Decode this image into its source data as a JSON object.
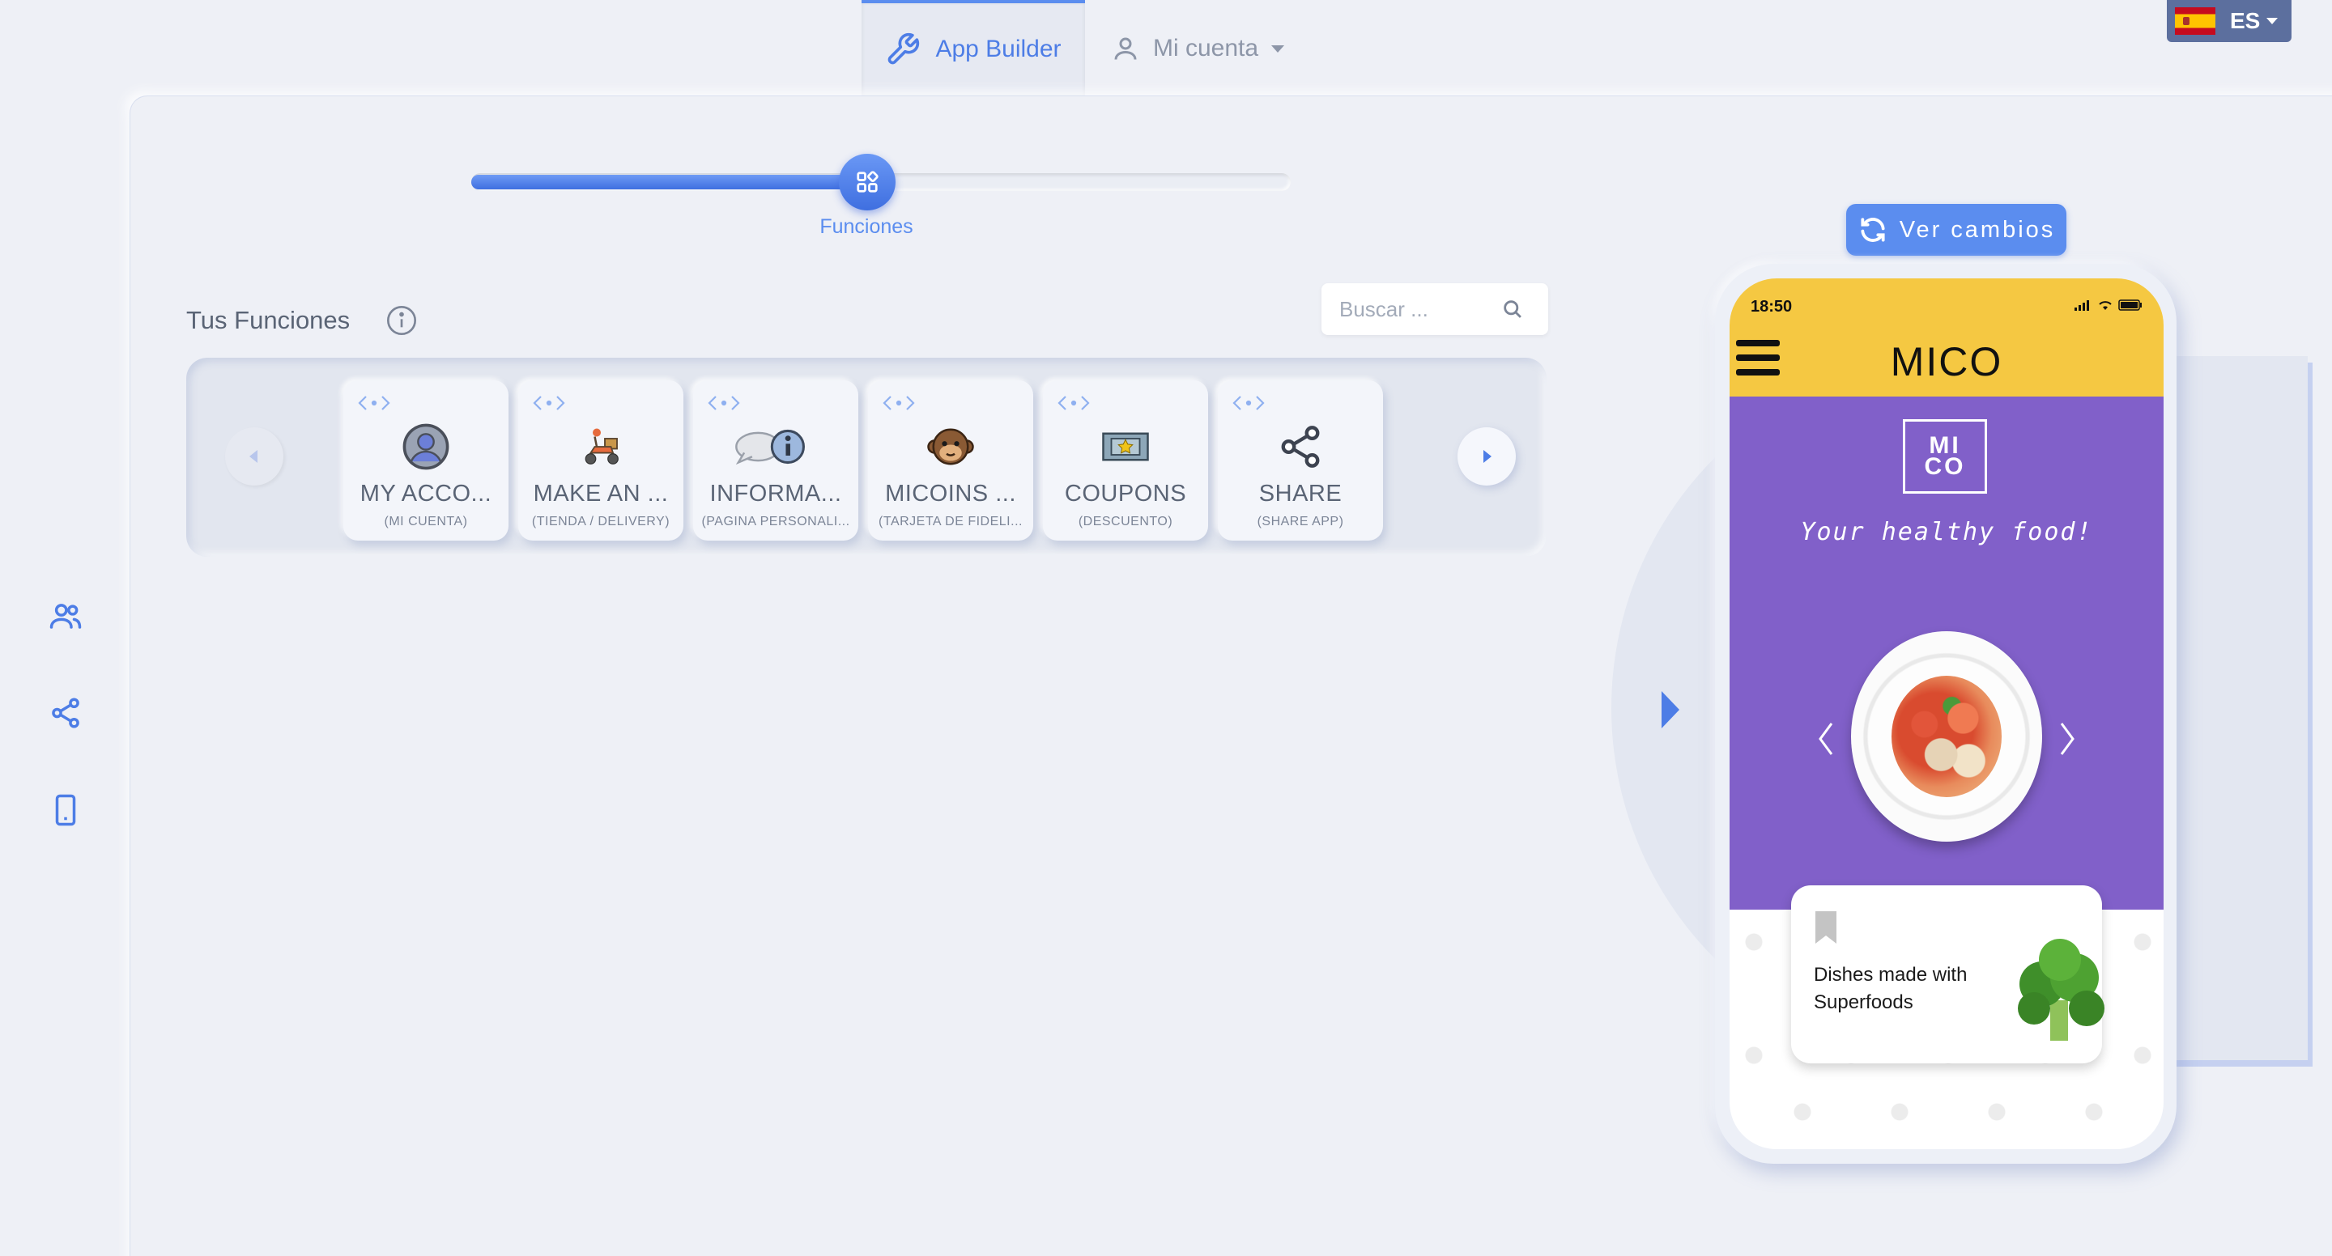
{
  "nav": {
    "builder_label": "App Builder",
    "account_label": "Mi cuenta",
    "language": "ES"
  },
  "progress": {
    "step_label": "Funciones",
    "fill_fraction": 0.5
  },
  "functions": {
    "title": "Tus Funciones",
    "search_placeholder": "Buscar ...",
    "cards": [
      {
        "title": "MY ACCO...",
        "subtitle": "(MI CUENTA)",
        "icon": "user-avatar-icon"
      },
      {
        "title": "MAKE AN ...",
        "subtitle": "(TIENDA / DELIVERY)",
        "icon": "delivery-scooter-icon"
      },
      {
        "title": "INFORMA...",
        "subtitle": "(PAGINA PERSONALI...",
        "icon": "info-speech-icon"
      },
      {
        "title": "MICOINS ...",
        "subtitle": "(TARJETA DE FIDELI...",
        "icon": "monkey-icon"
      },
      {
        "title": "COUPONS",
        "subtitle": "(DESCUENTO)",
        "icon": "coupon-ticket-icon"
      },
      {
        "title": "SHARE",
        "subtitle": "(SHARE APP)",
        "icon": "share-icon"
      }
    ]
  },
  "preview": {
    "button_label": "Ver cambios",
    "status_time": "18:50",
    "app_title": "MICO",
    "logo_line1": "MI",
    "logo_line2": "CO",
    "tagline": "Your healthy food!",
    "promo_text": "Dishes made with Superfoods"
  },
  "colors": {
    "accent": "#5b8def",
    "header_yellow": "#f5c842",
    "hero_purple": "#8160c9"
  }
}
